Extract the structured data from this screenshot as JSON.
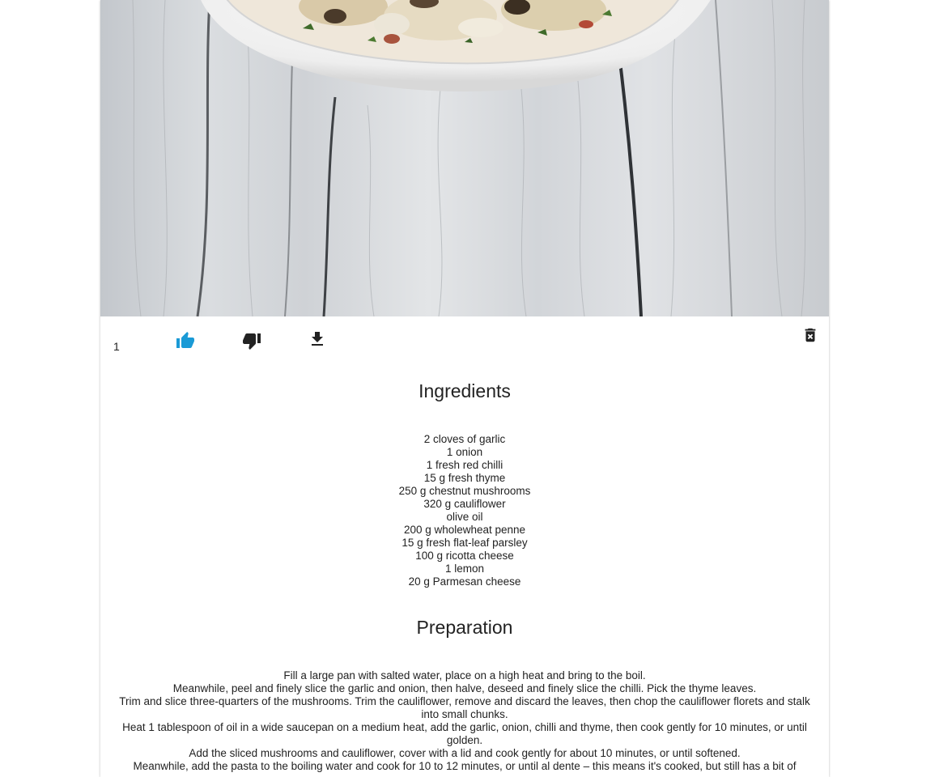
{
  "recipe": {
    "likes_count": "1",
    "colors": {
      "like_active": "#1a9ad6",
      "icon_default": "#222222"
    },
    "icons": {
      "like": "thumb-up-icon",
      "dislike": "thumb-down-icon",
      "download": "download-icon",
      "delete": "delete-icon"
    },
    "ingredients_title": "Ingredients",
    "ingredients": [
      "2 cloves of garlic",
      "1 onion",
      "1 fresh red chilli",
      "15 g fresh thyme",
      "250 g chestnut mushrooms",
      "320 g cauliflower",
      "olive oil",
      "200 g wholewheat penne",
      "15 g fresh flat-leaf parsley",
      "100 g ricotta cheese",
      "1 lemon",
      "20 g Parmesan cheese"
    ],
    "preparation_title": "Preparation",
    "preparation": [
      "Fill a large pan with salted water, place on a high heat and bring to the boil.",
      "Meanwhile, peel and finely slice the garlic and onion, then halve, deseed and finely slice the chilli. Pick the thyme leaves.",
      "Trim and slice three-quarters of the mushrooms. Trim the cauliflower, remove and discard the leaves, then chop the cauliflower florets and stalk into small chunks.",
      "Heat 1 tablespoon of oil in a wide saucepan on a medium heat, add the garlic, onion, chilli and thyme, then cook gently for 10 minutes, or until golden.",
      "Add the sliced mushrooms and cauliflower, cover with a lid and cook gently for about 10 minutes, or until softened.",
      "Meanwhile, add the pasta to the boiling water and cook for 10 to 12 minutes, or until al dente – this means it's cooked, but still has a bit of"
    ]
  }
}
